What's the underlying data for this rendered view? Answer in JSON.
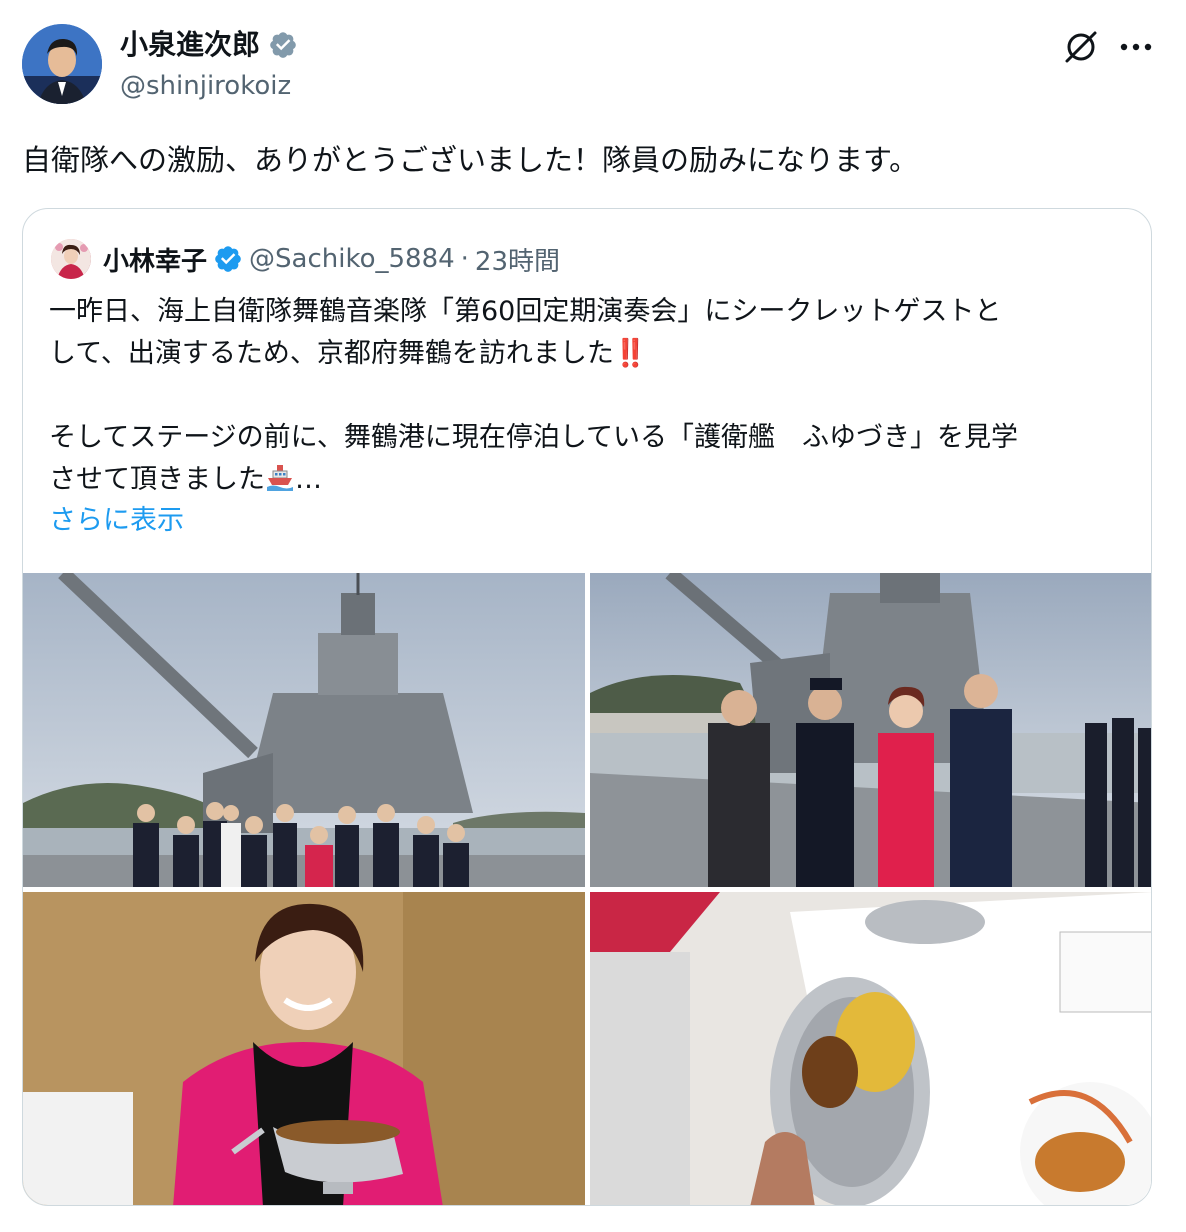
{
  "post": {
    "author_name": "小泉進次郎",
    "author_handle": "@shinjirokoiz",
    "text": "自衛隊への激励、ありがとうございました！隊員の励みになります。",
    "icons": {
      "verified": "verified-badge-icon",
      "grok": "grok-icon",
      "more": "more-options-icon"
    }
  },
  "quote": {
    "author_name": "小林幸子",
    "author_handle": "@Sachiko_5884",
    "separator": "·",
    "time": "23時間",
    "line1": "一昨日、海上自衛隊舞鶴音楽隊「第60回定期演奏会」にシークレットゲストと",
    "line2": "して、出演するため、京都府舞鶴を訪れました",
    "line2_emoji": "‼️",
    "line3": "そしてステージの前に、舞鶴港に現在停泊している「護衛艦　ふゆづき」を見学",
    "line4": "させて頂きました",
    "line4_suffix": "…",
    "show_more": "さらに表示",
    "images": [
      "ship-deck-group-photo",
      "ship-deck-four-people-photo",
      "woman-with-curry-photo",
      "curry-plate-photo"
    ]
  },
  "colors": {
    "text": "#0f1419",
    "muted": "#536471",
    "link": "#1d9bf0",
    "border": "#cfd9de",
    "verified": "#1d9bf0"
  }
}
